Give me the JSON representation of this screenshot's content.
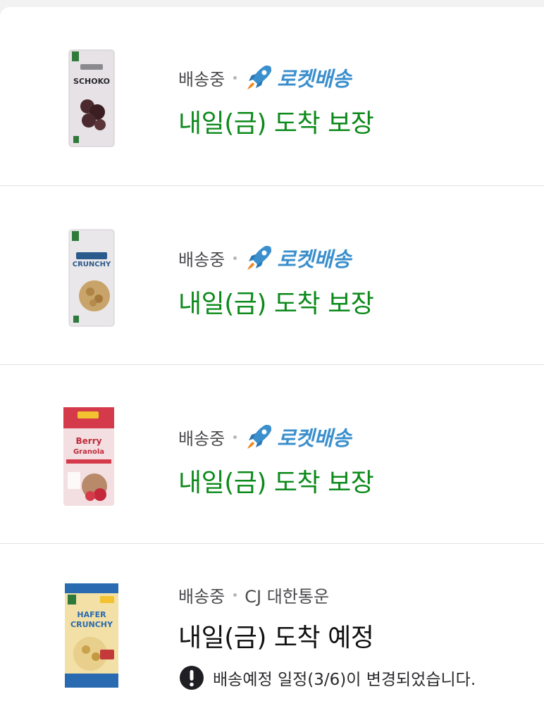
{
  "orders": [
    {
      "status": "배송중",
      "carrier": "로켓배송",
      "carrier_icon": "rocket-icon",
      "eta": "내일(금) 도착 보장",
      "eta_color": "#0c8a1b",
      "product": {
        "line1": "SCHOKO",
        "icon": "cereal-package-schoko"
      }
    },
    {
      "status": "배송중",
      "carrier": "로켓배송",
      "carrier_icon": "rocket-icon",
      "eta": "내일(금) 도착 보장",
      "eta_color": "#0c8a1b",
      "product": {
        "line1": "CRUNCHY",
        "icon": "cereal-package-crunchy"
      }
    },
    {
      "status": "배송중",
      "carrier": "로켓배송",
      "carrier_icon": "rocket-icon",
      "eta": "내일(금) 도착 보장",
      "eta_color": "#0c8a1b",
      "product": {
        "line1": "Berry",
        "line2": "Granola",
        "icon": "cereal-package-berry-granola"
      }
    },
    {
      "status": "배송중",
      "carrier": "CJ 대한통운",
      "eta": "내일(금) 도착 예정",
      "eta_color": "#111111",
      "notice": "배송예정 일정(3/6)이 변경되었습니다.",
      "notice_icon": "exclamation-circle-icon",
      "product": {
        "line1": "HAFER",
        "line2": "CRUNCHY",
        "icon": "cereal-package-hafer-crunchy"
      }
    }
  ],
  "colors": {
    "rocket_blue": "#3b8fcd",
    "guarantee_green": "#0c8a1b",
    "divider": "#e1e1e3"
  }
}
